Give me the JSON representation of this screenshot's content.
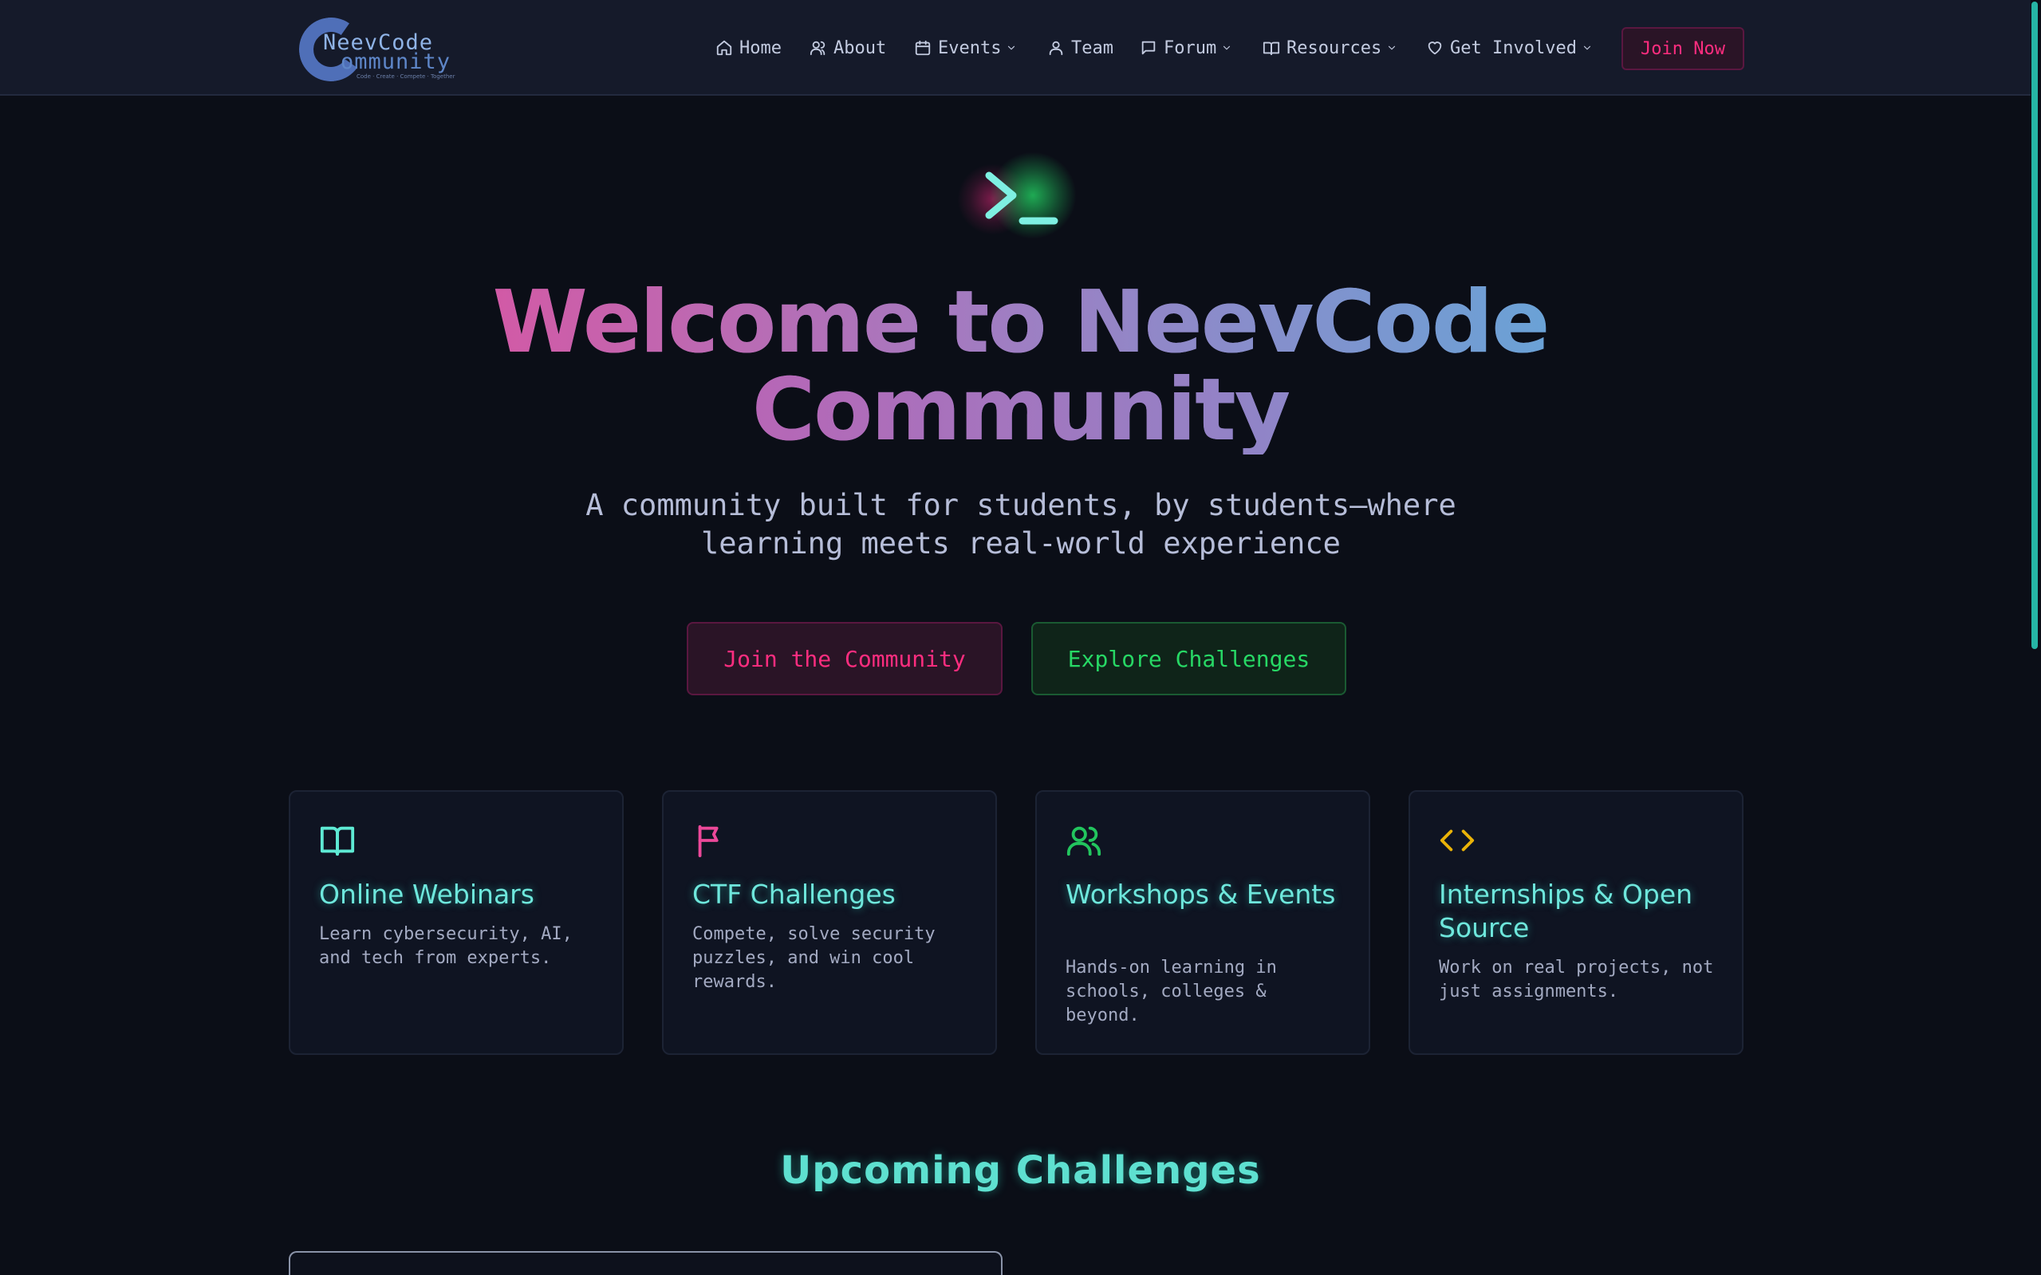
{
  "nav": {
    "logo": {
      "line1": "NeevCode",
      "line2": "ommunity",
      "tagline": "Code · Create · Compete · Together"
    },
    "items": [
      {
        "label": "Home",
        "icon": "home-icon",
        "dropdown": false
      },
      {
        "label": "About",
        "icon": "users-icon",
        "dropdown": false
      },
      {
        "label": "Events",
        "icon": "calendar-icon",
        "dropdown": true
      },
      {
        "label": "Team",
        "icon": "user-icon",
        "dropdown": false
      },
      {
        "label": "Forum",
        "icon": "message-icon",
        "dropdown": true
      },
      {
        "label": "Resources",
        "icon": "book-icon",
        "dropdown": true
      },
      {
        "label": "Get Involved",
        "icon": "heart-icon",
        "dropdown": true
      }
    ],
    "cta": "Join Now"
  },
  "hero": {
    "icon": "terminal-icon",
    "title_line1": "Welcome to NeevCode",
    "title_line2": "Community",
    "subtitle": "A community built for students, by students—where learning meets real-world experience",
    "primary_button": "Join the Community",
    "secondary_button": "Explore Challenges"
  },
  "features": [
    {
      "icon": "book-open-icon",
      "icon_color": "#5eead4",
      "title": "Online Webinars",
      "description": "Learn cybersecurity, AI, and tech from experts."
    },
    {
      "icon": "flag-icon",
      "icon_color": "#ec4899",
      "title": "CTF Challenges",
      "description": "Compete, solve security puzzles, and win cool rewards."
    },
    {
      "icon": "users-icon",
      "icon_color": "#22c55e",
      "title": "Workshops & Events",
      "description": "Hands-on learning in schools, colleges & beyond."
    },
    {
      "icon": "code-icon",
      "icon_color": "#eab308",
      "title": "Internships & Open Source",
      "description": "Work on real projects, not just assignments."
    }
  ],
  "upcoming": {
    "title": "Upcoming Challenges"
  },
  "colors": {
    "background": "#0b0e17",
    "navbar": "#151a2a",
    "accent_pink": "#ff2d7f",
    "accent_green": "#27d865",
    "accent_teal": "#5ee0d0"
  }
}
